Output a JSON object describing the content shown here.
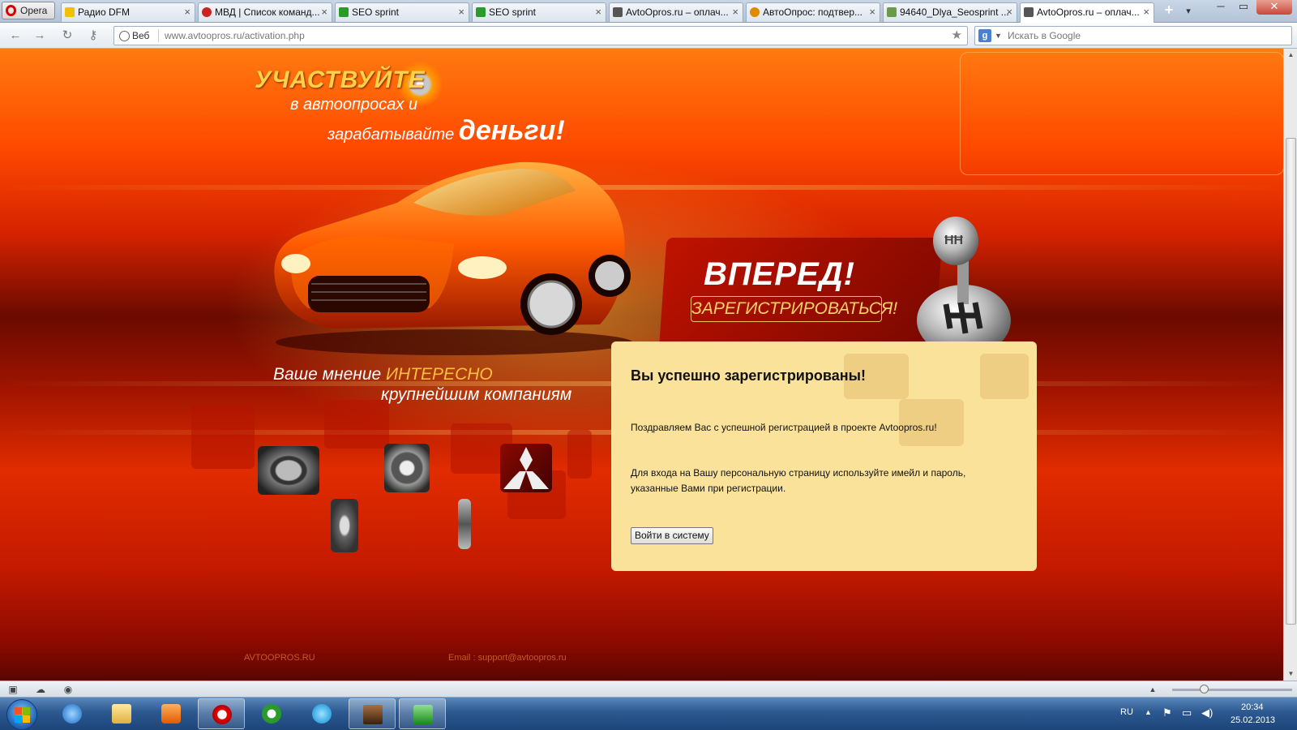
{
  "browser": {
    "menu_label": "Opera",
    "tabs": [
      {
        "label": "Радио DFM",
        "color": "#f0c000"
      },
      {
        "label": "МВД | Список команд...",
        "color": "#cc2222"
      },
      {
        "label": "SEO sprint",
        "color": "#2a9a2a"
      },
      {
        "label": "SEO sprint",
        "color": "#2a9a2a"
      },
      {
        "label": "AvtoOpros.ru – оплач...",
        "color": "#555555"
      },
      {
        "label": "АвтоОпрос: подтвер...",
        "color": "#e08a00"
      },
      {
        "label": "94640_Dlya_Seosprint ...",
        "color": "#6a9a4a"
      },
      {
        "label": "AvtoOpros.ru – оплач...",
        "color": "#555555"
      }
    ],
    "new_tab": "+",
    "tab_menu": "▾",
    "win_min": "─",
    "win_max": "▭",
    "win_close": "✕",
    "web_label": "Веб",
    "url_host": "www.avtoopros.ru",
    "url_path": "/activation.php",
    "search_engine": "g",
    "search_placeholder": "Искать в Google"
  },
  "page": {
    "slogan_call": "УЧАСТВУЙТЕ",
    "slogan_line2": "в автоопросах и",
    "slogan_line3": "зарабатывайте",
    "slogan_money": "деньги!",
    "opinion_prefix": "Ваше мнение",
    "opinion_accent": "ИНТЕРЕСНО",
    "opinion_line2": "крупнейшим компаниям",
    "promo_title": "ВПЕРЕД!",
    "promo_button": "ЗАРЕГИСТРИРОВАТЬСЯ!",
    "card": {
      "title": "Вы успешно зарегистрированы!",
      "congrats": "Поздравляем Вас с успешной регистрацией в проекте Avtoopros.ru!",
      "instructions_line1": "Для входа на Вашу персональную страницу используйте имейл и пароль,",
      "instructions_line2": "указанные Вами при регистрации.",
      "login_button": "Войти в систему"
    },
    "footer_site": "AVTOOPROS.RU",
    "footer_email": "Email : support@avtoopros.ru"
  },
  "taskbar": {
    "lang": "RU",
    "time": "20:34",
    "date": "25.02.2013"
  },
  "colors": {
    "accent_yellow": "#ffd24a",
    "card_bg": "#fbe29a",
    "brand_red": "#c01200"
  }
}
